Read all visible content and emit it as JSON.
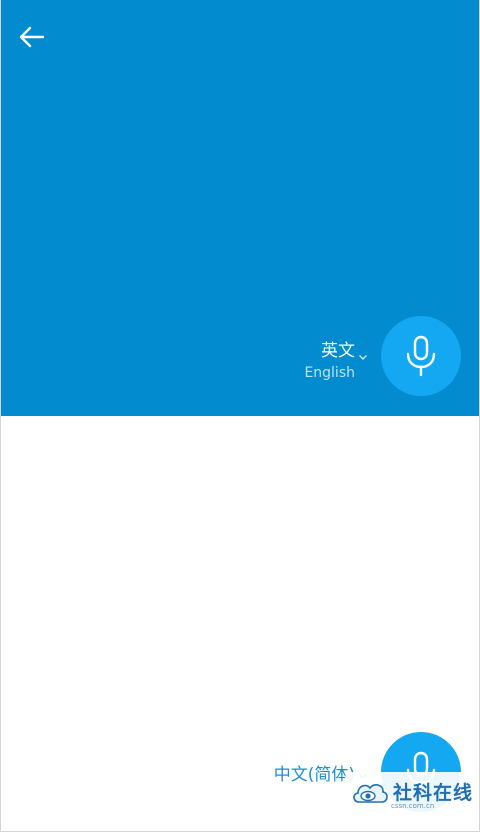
{
  "navigation": {
    "back_icon": "arrow-left-icon"
  },
  "source_language": {
    "name": "英文",
    "subtitle": "English",
    "dropdown_icon": "chevron-down-icon"
  },
  "target_language": {
    "name": "中文(简体)",
    "dropdown_icon": "chevron-down-icon"
  },
  "mic": {
    "icon": "microphone-icon"
  },
  "watermark": {
    "text": "社科在线",
    "url": "cssn.com.cn"
  },
  "colors": {
    "top_panel": "#028bcf",
    "mic_button": "#14a8f3",
    "accent_text": "#1a8fd0"
  }
}
